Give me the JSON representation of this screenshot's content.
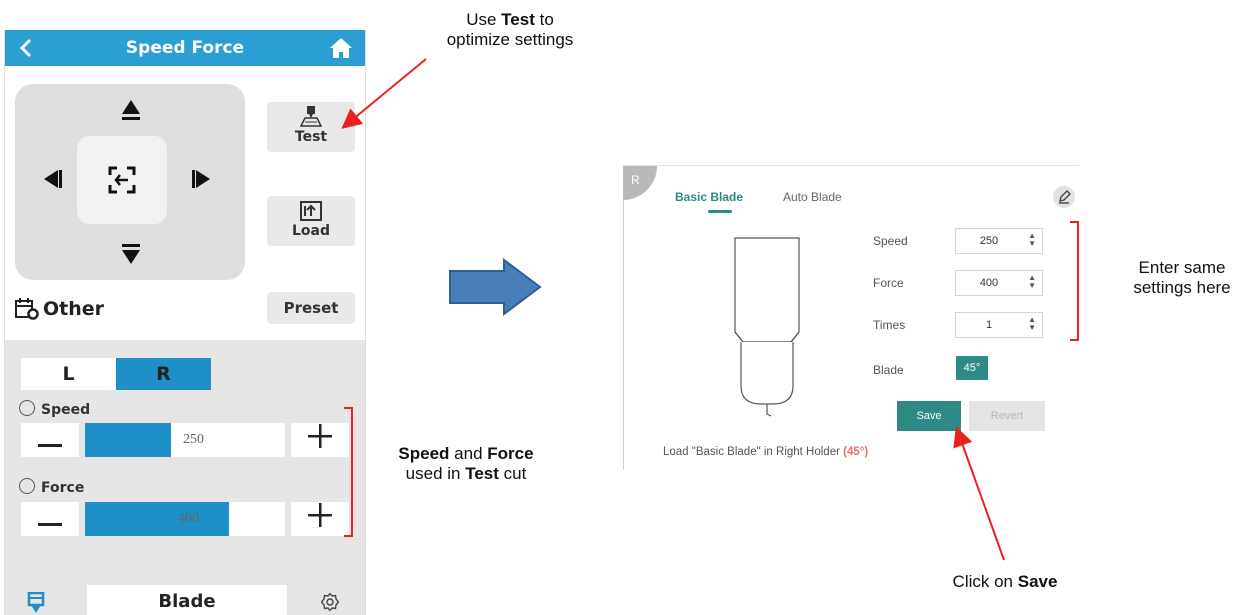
{
  "phone": {
    "header": {
      "title": "Speed Force"
    },
    "test_button": {
      "label": "Test"
    },
    "load_button": {
      "label": "Load"
    },
    "material": {
      "name": "Other"
    },
    "preset_button": {
      "label": "Preset"
    },
    "holder_tabs": {
      "left": "L",
      "right": "R",
      "selected": "R"
    },
    "speed": {
      "label": "Speed",
      "value": "250",
      "fill_fraction": 0.43
    },
    "force": {
      "label": "Force",
      "value": "400",
      "fill_fraction": 0.72
    },
    "blade": {
      "name": "Blade"
    },
    "colors": {
      "accent": "#2b9fd3",
      "slider_fill": "#1e8fc7"
    }
  },
  "software": {
    "holder_badge": "R",
    "tabs": [
      "Basic Blade",
      "Auto Blade"
    ],
    "selected_tab": "Basic Blade",
    "fields": {
      "speed": {
        "label": "Speed",
        "value": "250"
      },
      "force": {
        "label": "Force",
        "value": "400"
      },
      "times": {
        "label": "Times",
        "value": "1"
      },
      "blade": {
        "label": "Blade",
        "value": "45°"
      }
    },
    "save_label": "Save",
    "revert_label": "Revert",
    "load_message": {
      "text": "Load \"Basic Blade\" in Right Holder",
      "angle": "(45°)"
    },
    "colors": {
      "accent": "#2d8a86",
      "angle_highlight": "#ef6a6a"
    }
  },
  "annotations": {
    "test_note": {
      "prefix": "Use ",
      "bold": "Test",
      "suffix": " to",
      "line2": "optimize settings"
    },
    "speed_force_note": {
      "bold1": "Speed",
      "mid": " and ",
      "bold2": "Force",
      "line2_prefix": "used in ",
      "line2_bold": "Test",
      "line2_suffix": " cut"
    },
    "enter_note": {
      "line1": "Enter same",
      "line2": "settings here"
    },
    "click_note": {
      "prefix": "Click on ",
      "bold": "Save"
    },
    "colors": {
      "arrow_red": "#e8231f",
      "big_arrow": "#4a7ebb"
    }
  }
}
